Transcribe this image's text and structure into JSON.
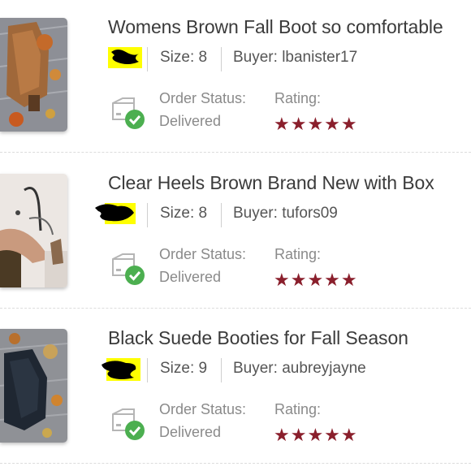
{
  "labels": {
    "status": "Order Status:",
    "rating": "Rating:",
    "size_prefix": "Size: ",
    "buyer_prefix": "Buyer: "
  },
  "colors": {
    "star": "#8a1f2c",
    "check": "#4caf50",
    "highlight": "#ffff00"
  },
  "orders": [
    {
      "title": "Womens Brown Fall Boot so comfortable",
      "size": "8",
      "buyer": "lbanister17",
      "status": "Delivered",
      "rating": 5,
      "stars": "★★★★★"
    },
    {
      "title": "Clear Heels Brown Brand New with Box",
      "size": "8",
      "buyer": "tufors09",
      "status": "Delivered",
      "rating": 5,
      "stars": "★★★★★"
    },
    {
      "title": "Black Suede Booties for Fall Season",
      "size": "9",
      "buyer": "aubreyjayne",
      "status": "Delivered",
      "rating": 5,
      "stars": "★★★★★"
    }
  ]
}
